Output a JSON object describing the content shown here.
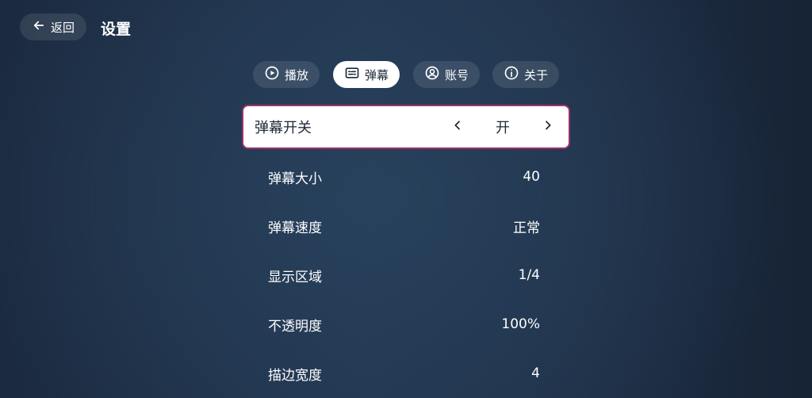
{
  "header": {
    "back_label": "返回",
    "title": "设置"
  },
  "tabs": [
    {
      "label": "播放",
      "icon": "play-circle-icon",
      "active": false
    },
    {
      "label": "弹幕",
      "icon": "subtitles-icon",
      "active": true
    },
    {
      "label": "账号",
      "icon": "account-circle-icon",
      "active": false
    },
    {
      "label": "关于",
      "icon": "info-icon",
      "active": false
    }
  ],
  "settings": [
    {
      "label": "弹幕开关",
      "value": "开",
      "focused": true
    },
    {
      "label": "弹幕大小",
      "value": "40"
    },
    {
      "label": "弹幕速度",
      "value": "正常"
    },
    {
      "label": "显示区域",
      "value": "1/4"
    },
    {
      "label": "不透明度",
      "value": "100%"
    },
    {
      "label": "描边宽度",
      "value": "4"
    }
  ],
  "colors": {
    "focus_border": "#a0306a",
    "background": "#223650",
    "active_tab": "#ffffff"
  }
}
